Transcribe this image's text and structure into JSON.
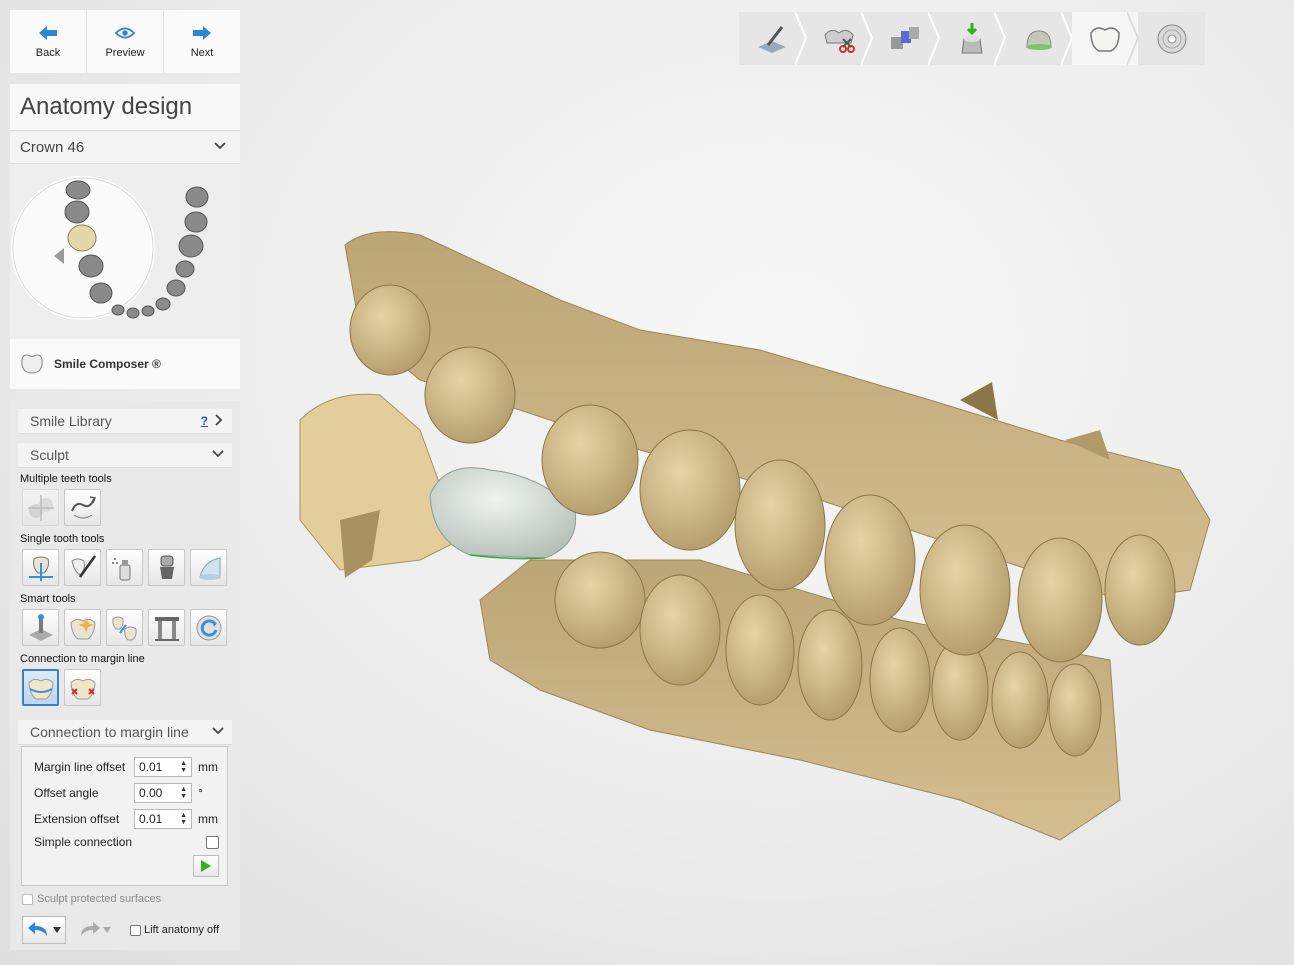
{
  "nav": {
    "back_label": "Back",
    "preview_label": "Preview",
    "next_label": "Next"
  },
  "header": {
    "title": "Anatomy design",
    "selected_restoration": "Crown 46",
    "smile_composer_label": "Smile Composer ®"
  },
  "tools": {
    "smile_library_label": "Smile Library",
    "smile_library_help": "?",
    "sculpt_label": "Sculpt",
    "multiple_teeth_tools_label": "Multiple teeth tools",
    "single_tooth_tools_label": "Single tooth tools",
    "smart_tools_label": "Smart tools",
    "connection_to_margin_line_label": "Connection to margin line"
  },
  "margin_panel": {
    "title": "Connection to margin line",
    "margin_line_offset_label": "Margin line offset",
    "margin_line_offset_value": "0.01",
    "margin_line_offset_unit": "mm",
    "offset_angle_label": "Offset angle",
    "offset_angle_value": "0.00",
    "offset_angle_unit": "°",
    "extension_offset_label": "Extension offset",
    "extension_offset_value": "0.01",
    "extension_offset_unit": "mm",
    "simple_connection_label": "Simple connection",
    "simple_connection_checked": false
  },
  "footer": {
    "sculpt_protected_label": "Sculpt protected surfaces",
    "lift_anatomy_off_label": "Lift anatomy off"
  },
  "wizard_steps": [
    {
      "icon": "scan-margin-icon",
      "active": false
    },
    {
      "icon": "cut-model-icon",
      "active": false
    },
    {
      "icon": "insertion-axis-icon",
      "active": false
    },
    {
      "icon": "die-design-icon",
      "active": false
    },
    {
      "icon": "coping-icon",
      "active": false
    },
    {
      "icon": "anatomy-icon",
      "active": true
    },
    {
      "icon": "save-disc-icon",
      "active": false
    }
  ],
  "colors": {
    "model": "#c9b183",
    "crown": "#d3dcd6",
    "accent": "#3a8fd9",
    "play_green": "#2fb21a"
  }
}
